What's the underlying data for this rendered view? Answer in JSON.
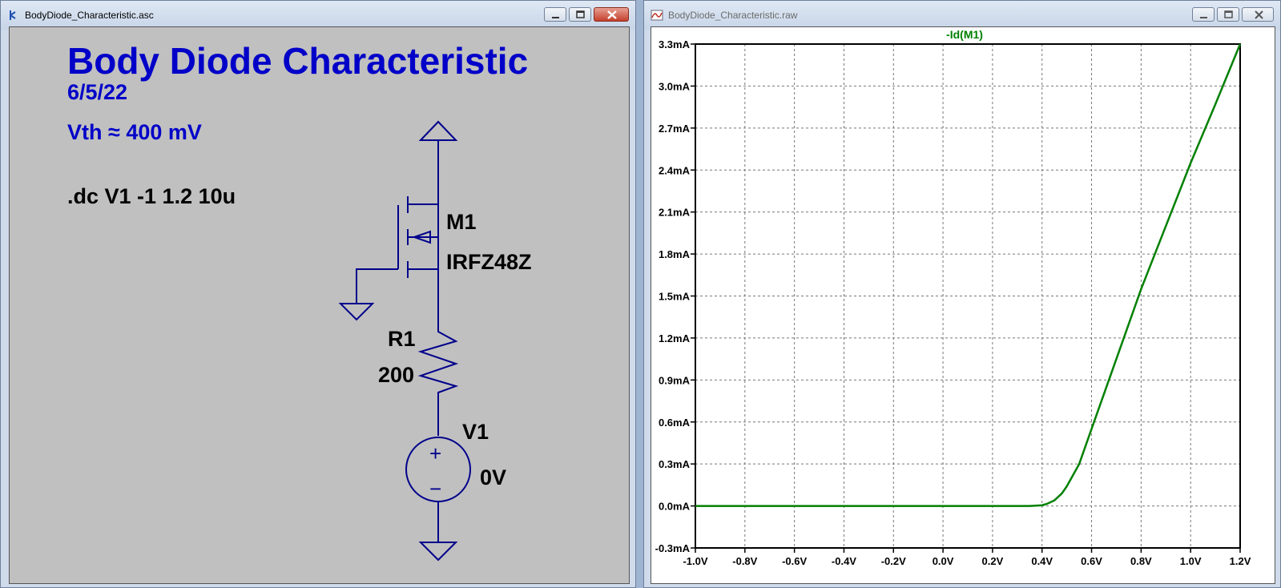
{
  "schematic_window": {
    "title": "BodyDiode_Characteristic.asc",
    "heading": "Body Diode Characteristic",
    "date": "6/5/22",
    "vth_note": "Vth ≈ 400 mV",
    "directive": ".dc V1 -1 1.2 10u",
    "mosfet_name": "M1",
    "mosfet_model": "IRFZ48Z",
    "resistor_name": "R1",
    "resistor_value": "200",
    "source_name": "V1",
    "source_value": "0V",
    "source_plus": "+",
    "source_minus": "−",
    "colors": {
      "annotation": "#0000c8",
      "wire": "#00008b",
      "background": "#c0c0c0"
    }
  },
  "waveform_window": {
    "title": "BodyDiode_Characteristic.raw",
    "trace_color": "#008000"
  },
  "chart_data": {
    "type": "line",
    "title": "-Id(M1)",
    "xlabel": "",
    "ylabel": "",
    "xlim": [
      -1.0,
      1.2
    ],
    "ylim": [
      -0.3,
      3.3
    ],
    "x_ticks": [
      -1.0,
      -0.8,
      -0.6,
      -0.4,
      -0.2,
      0.0,
      0.2,
      0.4,
      0.6,
      0.8,
      1.0,
      1.2
    ],
    "x_tick_labels": [
      "-1.0V",
      "-0.8V",
      "-0.6V",
      "-0.4V",
      "-0.2V",
      "0.0V",
      "0.2V",
      "0.4V",
      "0.6V",
      "0.8V",
      "1.0V",
      "1.2V"
    ],
    "y_ticks": [
      -0.3,
      0.0,
      0.3,
      0.6,
      0.9,
      1.2,
      1.5,
      1.8,
      2.1,
      2.4,
      2.7,
      3.0,
      3.3
    ],
    "y_tick_labels": [
      "-0.3mA",
      "0.0mA",
      "0.3mA",
      "0.6mA",
      "0.9mA",
      "1.2mA",
      "1.5mA",
      "1.8mA",
      "2.1mA",
      "2.4mA",
      "2.7mA",
      "3.0mA",
      "3.3mA"
    ],
    "grid": true,
    "series": [
      {
        "name": "-Id(M1)",
        "x": [
          -1.0,
          0.0,
          0.3,
          0.35,
          0.4,
          0.42,
          0.45,
          0.48,
          0.5,
          0.55,
          0.6,
          0.7,
          0.8,
          0.9,
          1.0,
          1.1,
          1.2
        ],
        "y": [
          0.0,
          0.0,
          0.0,
          0.0,
          0.005,
          0.015,
          0.04,
          0.09,
          0.14,
          0.3,
          0.55,
          1.05,
          1.55,
          2.0,
          2.45,
          2.87,
          3.3
        ]
      }
    ]
  }
}
